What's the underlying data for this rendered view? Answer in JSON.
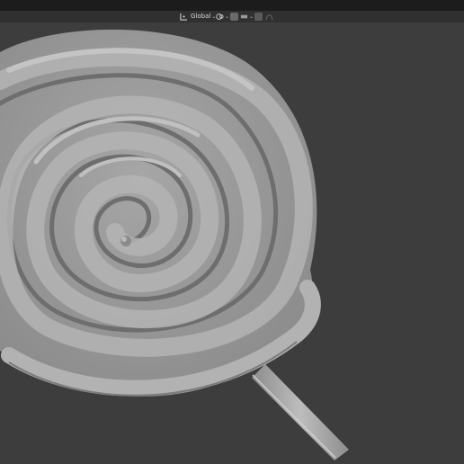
{
  "header": {
    "transform_orientation": {
      "icon": "transform-orientation-icon",
      "value": "Global"
    },
    "pivot_point": {
      "icon": "pivot-point-icon"
    },
    "snapping": {
      "icon": "snap-icon"
    },
    "proportional_editing": {
      "icon": "proportional-editing-icon"
    },
    "falloff": {
      "icon": "falloff-icon"
    }
  },
  "viewport": {
    "background": "#3d3d3d",
    "object": "lollipop-sculpt",
    "mesh_color": "#9e9e9e",
    "stick_color": "#a8a8a8"
  }
}
